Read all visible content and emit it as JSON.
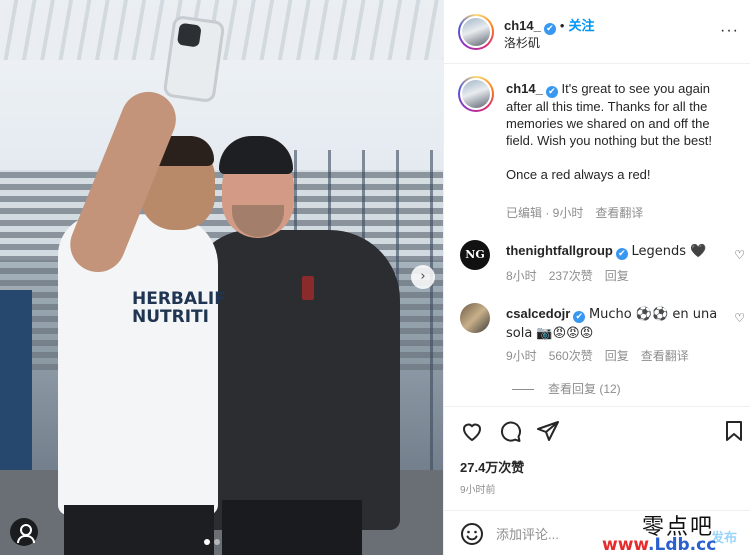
{
  "post": {
    "username": "ch14_",
    "verified_mark": "✔",
    "separator": "•",
    "follow_label": "关注",
    "location": "洛杉矶",
    "more_label": "···"
  },
  "photo": {
    "jersey_line1": "HERBALIF",
    "jersey_line2": "NUTRITI",
    "next_label": "›",
    "slides": 2,
    "active_slide": 1
  },
  "caption": {
    "username": "ch14_",
    "text1": "It's great to see you again after all this time. Thanks for all the memories we shared on and off the field. Wish you nothing but the best!",
    "text2": "Once a red always a red!",
    "edited": "已编辑 · 9小时",
    "translate": "查看翻译"
  },
  "comments": [
    {
      "username": "thenightfallgroup",
      "avatar_text": "NG",
      "text": "Legends 🖤",
      "time": "8小时",
      "likes": "237次赞",
      "reply": "回复",
      "translate": ""
    },
    {
      "username": "csalcedojr",
      "avatar_text": "",
      "text": "Mucho ⚽⚽ en una sola 📷😡😡😡",
      "time": "9小时",
      "likes": "560次赞",
      "reply": "回复",
      "translate": "查看翻译"
    }
  ],
  "view_replies": "查看回复 (12)",
  "likes_total": "27.4万次赞",
  "time_ago": "9小时前",
  "add_comment": {
    "placeholder": "添加评论...",
    "post_label": "发布"
  },
  "watermark": {
    "cn": "零点吧",
    "url_red": "www",
    "url_rest": ".Ldb.cc"
  },
  "icons": [
    "heart-icon",
    "comment-icon",
    "share-icon",
    "save-icon",
    "emoji-icon",
    "more-icon",
    "tag-icon"
  ],
  "colors": {
    "accent": "#0095f6",
    "verified": "#3897f0",
    "muted": "#8e8e8e",
    "text": "#262626"
  }
}
